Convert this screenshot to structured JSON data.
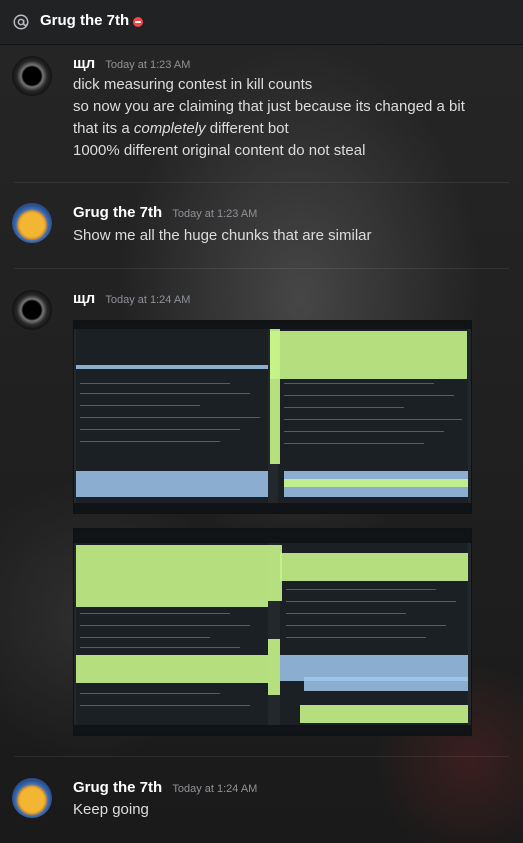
{
  "channel": {
    "title": "Grug the 7th",
    "status": "dnd",
    "status_color": "#f04747"
  },
  "messages": [
    {
      "author": "щл",
      "timestamp": "Today at 1:23 AM",
      "avatar": "void-eclipse-avatar",
      "lines": [
        "dick measuring contest in kill counts",
        "so now you are claiming that just because its changed a bit",
        [
          "that its a ",
          "completely",
          " different bot"
        ],
        "1000% different original content do not steal"
      ]
    },
    {
      "author": "Grug the 7th",
      "timestamp": "Today at 1:23 AM",
      "avatar": "winnie-the-pooh-avatar",
      "lines": [
        "Show me all the huge chunks that are similar"
      ]
    },
    {
      "author": "щл",
      "timestamp": "Today at 1:24 AM",
      "avatar": "void-eclipse-avatar",
      "attachments": [
        "code-diff-screenshot",
        "code-diff-screenshot"
      ]
    },
    {
      "author": "Grug the 7th",
      "timestamp": "Today at 1:24 AM",
      "avatar": "winnie-the-pooh-avatar",
      "lines": [
        "Keep going"
      ]
    }
  ],
  "colors": {
    "diff_added": "#c7f48a",
    "diff_changed": "#9fc7ef",
    "editor_bg": "#1b2024"
  }
}
